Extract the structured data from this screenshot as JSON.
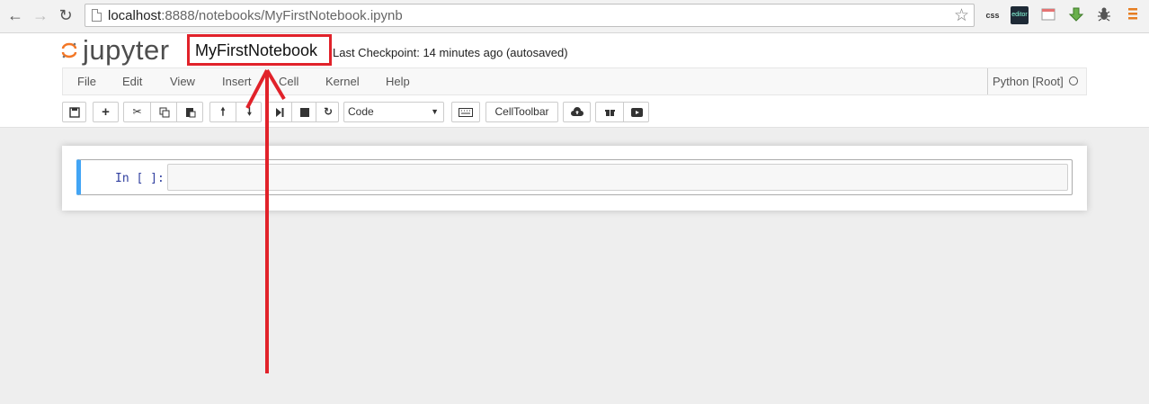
{
  "browser": {
    "url_host": "localhost",
    "url_rest": ":8888/notebooks/MyFirstNotebook.ipynb",
    "extensions": [
      "css",
      "editor"
    ]
  },
  "header": {
    "logo_text": "jupyter",
    "notebook_name": "MyFirstNotebook",
    "checkpoint": "Last Checkpoint: 14 minutes ago (autosaved)"
  },
  "menu": {
    "items": [
      "File",
      "Edit",
      "View",
      "Insert",
      "Cell",
      "Kernel",
      "Help"
    ],
    "kernel": "Python [Root]"
  },
  "toolbar": {
    "cell_type": "Code",
    "celltoolbar_label": "CellToolbar"
  },
  "cell": {
    "prompt": "In [ ]:"
  },
  "colors": {
    "accent_blue": "#42a5f5",
    "annotation_red": "#e1222a",
    "jupyter_orange": "#f37726"
  }
}
